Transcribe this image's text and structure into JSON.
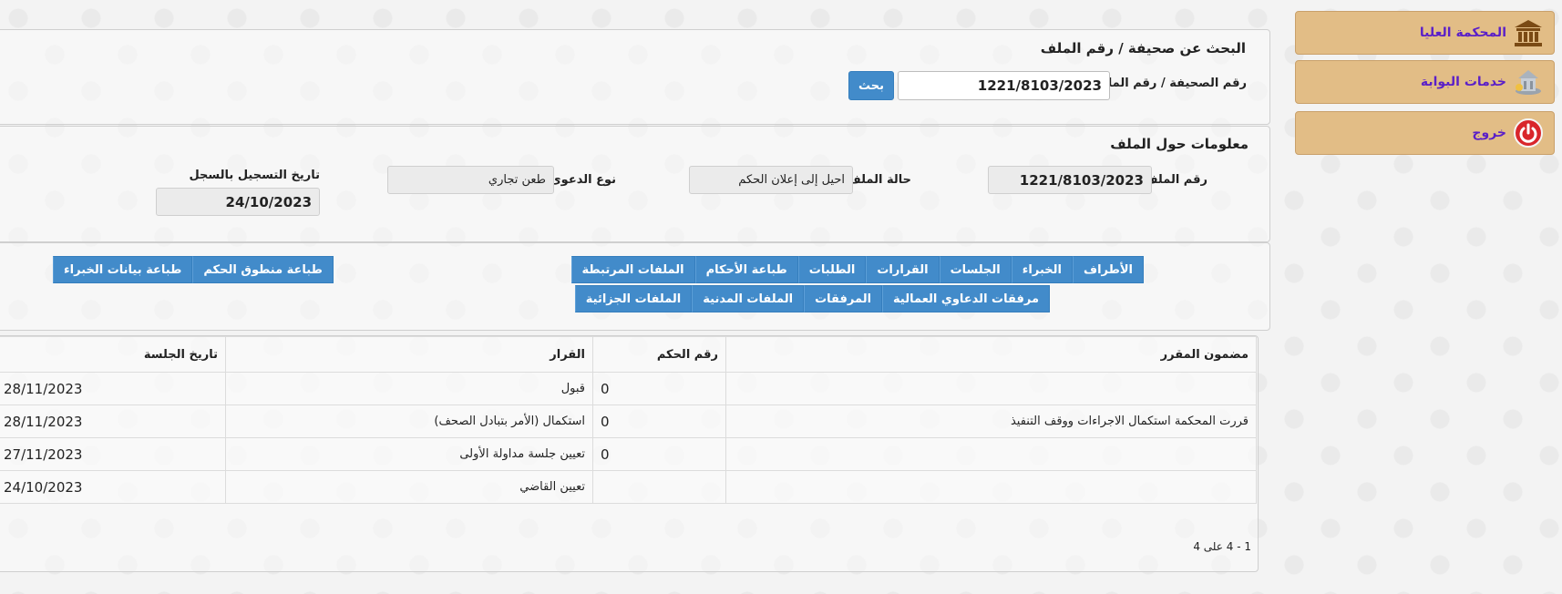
{
  "sidebar": {
    "items": [
      {
        "label": "المحكمة العليا",
        "icon": "court-building-icon"
      },
      {
        "label": "خدمات البوابة",
        "icon": "portal-services-icon"
      },
      {
        "label": "خروج",
        "icon": "power-icon"
      }
    ]
  },
  "search": {
    "title": "البحث عن صحيفة / رقم الملف",
    "label": "رقم الصحيفة / رقم الملف",
    "value": "1221/8103/2023",
    "button": "بحث"
  },
  "info": {
    "title": "معلومات حول الملف",
    "file_number_label": "رقم الملف",
    "file_number": "1221/8103/2023",
    "status_label": "حالة الملف",
    "status": "احيل إلى إعلان الحكم",
    "case_type_label": "نوع الدعوى",
    "case_type": "طعن تجاري",
    "reg_date_label": "تاريخ التسجيل بالسجل",
    "reg_date": "24/10/2023"
  },
  "tabs": {
    "row1": [
      "الأطراف",
      "الخبراء",
      "الجلسات",
      "القرارات",
      "الطلبات",
      "طباعة الأحكام",
      "الملفات المرتبطة"
    ],
    "row2": [
      "مرفقات الدعاوي العمالية",
      "المرفقات",
      "الملفات المدنية",
      "الملفات الجزائية"
    ],
    "print": [
      "طباعة منطوق الحكم",
      "طباعة بيانات الخبراء"
    ]
  },
  "table": {
    "headers": [
      "مضمون المقرر",
      "رقم الحكم",
      "القرار",
      "تاريخ الجلسة"
    ],
    "rows": [
      [
        "",
        "0",
        "قبول",
        "28/11/2023"
      ],
      [
        "قررت المحكمة استكمال الاجراءات ووقف التنفيذ",
        "0",
        "استكمال (الأمر بتبادل الصحف)",
        "28/11/2023"
      ],
      [
        "",
        "0",
        "تعيين جلسة مداولة الأولى",
        "27/11/2023"
      ],
      [
        "",
        "",
        "تعيين القاضي",
        "24/10/2023"
      ]
    ],
    "pager": "1 - 4 على 4"
  },
  "colors": {
    "accent": "#428bca",
    "sidebar_bg": "#e2bd86",
    "sidebar_text": "#5a1fc8"
  }
}
